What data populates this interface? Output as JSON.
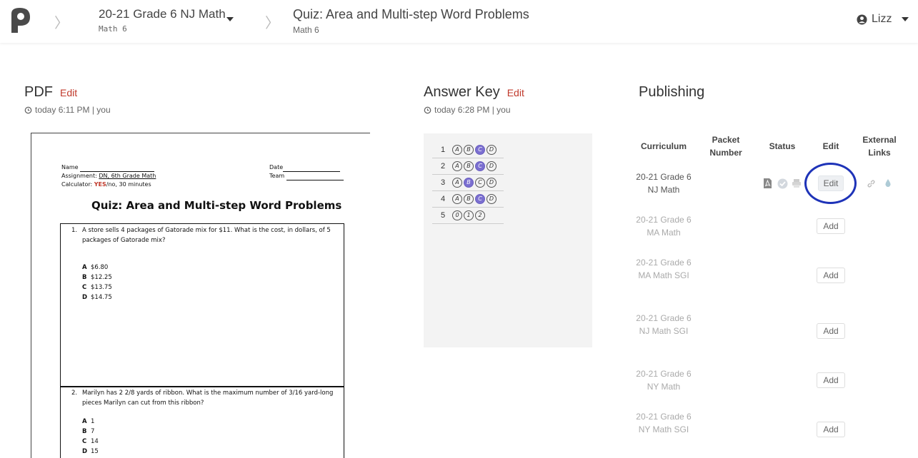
{
  "header": {
    "breadcrumb1": {
      "title": "20-21 Grade 6 NJ Math",
      "subtitle": "Math 6"
    },
    "breadcrumb2": {
      "title": "Quiz: Area and Multi-step Word Problems",
      "subtitle": "Math 6"
    },
    "user": "Lizz"
  },
  "pdf": {
    "title": "PDF",
    "edit": "Edit",
    "meta": "today 6:11 PM | you",
    "doc": {
      "name_label": "Name",
      "assignment_label": "Assignment:",
      "assignment_value": "DN, 6th Grade Math",
      "calculator_label": "Calculator:",
      "calculator_yes": "YES",
      "calculator_rest": "/no, 30 minutes",
      "date_label": "Date",
      "team_label": "Team",
      "quiz_title": "Quiz: Area and Multi-step Word Problems",
      "q1": {
        "num": "1.",
        "text": "A store sells 4 packages of Gatorade mix for $11. What is the cost, in dollars, of 5 packages of Gatorade mix?",
        "choices": [
          {
            "letter": "A",
            "value": "$6.80"
          },
          {
            "letter": "B",
            "value": "$12.25"
          },
          {
            "letter": "C",
            "value": "$13.75"
          },
          {
            "letter": "D",
            "value": "$14.75"
          }
        ]
      },
      "q2": {
        "num": "2.",
        "text": "Marilyn has 2 2/8 yards of ribbon. What is the maximum number of 3/16 yard-long pieces Marilyn can cut from this ribbon?",
        "choices": [
          {
            "letter": "A",
            "value": "1"
          },
          {
            "letter": "B",
            "value": "7"
          },
          {
            "letter": "C",
            "value": "14"
          },
          {
            "letter": "D",
            "value": "15"
          }
        ]
      }
    }
  },
  "answer_key": {
    "title": "Answer Key",
    "edit": "Edit",
    "meta": "today 6:28 PM | you",
    "rows": [
      {
        "num": "1",
        "bubbles": [
          "A",
          "B",
          "C",
          "D"
        ],
        "selected": "C"
      },
      {
        "num": "2",
        "bubbles": [
          "A",
          "B",
          "C",
          "D"
        ],
        "selected": "C"
      },
      {
        "num": "3",
        "bubbles": [
          "A",
          "B",
          "C",
          "D"
        ],
        "selected": "B"
      },
      {
        "num": "4",
        "bubbles": [
          "A",
          "B",
          "C",
          "D"
        ],
        "selected": "C"
      },
      {
        "num": "5",
        "bubbles": [
          "0",
          "1",
          "2"
        ],
        "selected": ""
      }
    ]
  },
  "publishing": {
    "title": "Publishing",
    "columns": [
      "Curriculum",
      "Packet Number",
      "Status",
      "Edit",
      "External Links"
    ],
    "rows": [
      {
        "curriculum": "20-21 Grade 6 NJ Math",
        "action": "Edit"
      },
      {
        "curriculum": "20-21 Grade 6 MA Math",
        "action": "Add"
      },
      {
        "curriculum": "20-21 Grade 6 MA Math SGI",
        "action": "Add"
      },
      {
        "curriculum": "20-21 Grade 6 NJ Math SGI",
        "action": "Add"
      },
      {
        "curriculum": "20-21 Grade 6 NY Math",
        "action": "Add"
      },
      {
        "curriculum": "20-21 Grade 6 NY Math SGI",
        "action": "Add"
      }
    ]
  },
  "colors": {
    "accent_red": "#c0392b",
    "bubble_selected": "#7b6fd0",
    "annotation_circle": "#1e33b8"
  },
  "icons": [
    "logo-icon",
    "clock-icon",
    "user-icon",
    "pdf-icon",
    "check-icon",
    "print-icon",
    "link-icon",
    "drop-icon"
  ]
}
